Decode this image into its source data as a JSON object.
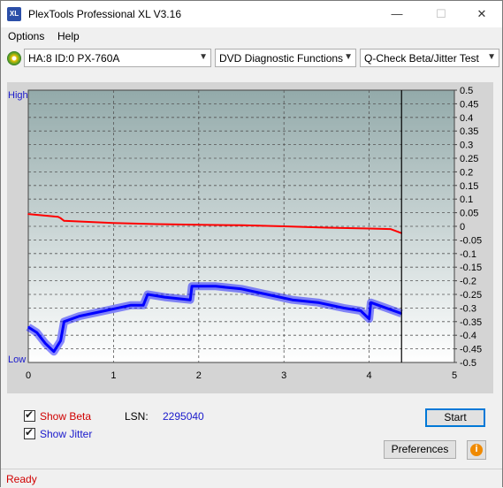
{
  "window": {
    "title": "PlexTools Professional XL V3.16",
    "icon_label": "XL",
    "controls": {
      "minimize": "—",
      "maximize": "☐",
      "close": "✕"
    }
  },
  "menu": {
    "options": "Options",
    "help": "Help"
  },
  "toolbar": {
    "drive": "HA:8 ID:0  PX-760A",
    "function": "DVD Diagnostic Functions",
    "test": "Q-Check Beta/Jitter Test"
  },
  "chart_data": {
    "type": "line",
    "y_labels_left": {
      "top": "High",
      "bottom": "Low"
    },
    "xlim": [
      0,
      5
    ],
    "x_ticks": [
      "0",
      "1",
      "2",
      "3",
      "4",
      "5"
    ],
    "ylim": [
      -0.5,
      0.5
    ],
    "y_ticks": [
      "0.5",
      "0.45",
      "0.4",
      "0.35",
      "0.3",
      "0.25",
      "0.2",
      "0.15",
      "0.1",
      "0.05",
      "0",
      "-0.05",
      "-0.1",
      "-0.15",
      "-0.2",
      "-0.25",
      "-0.3",
      "-0.35",
      "-0.4",
      "-0.45",
      "-0.5"
    ],
    "end_marker_x": 4.38,
    "grid": true,
    "series": [
      {
        "color": "#ff0000",
        "points": [
          [
            0,
            0.045
          ],
          [
            0.35,
            0.035
          ],
          [
            0.38,
            0.03
          ],
          [
            0.42,
            0.02
          ],
          [
            1,
            0.012
          ],
          [
            1.5,
            0.008
          ],
          [
            2,
            0.006
          ],
          [
            2.5,
            0.004
          ],
          [
            3,
            0.0
          ],
          [
            3.5,
            -0.005
          ],
          [
            4,
            -0.008
          ],
          [
            4.25,
            -0.01
          ],
          [
            4.38,
            -0.025
          ]
        ]
      },
      {
        "color": "#0000ff",
        "points": [
          [
            0,
            -0.37
          ],
          [
            0.1,
            -0.39
          ],
          [
            0.2,
            -0.43
          ],
          [
            0.3,
            -0.46
          ],
          [
            0.38,
            -0.42
          ],
          [
            0.42,
            -0.35
          ],
          [
            0.6,
            -0.33
          ],
          [
            0.9,
            -0.31
          ],
          [
            1.2,
            -0.29
          ],
          [
            1.35,
            -0.29
          ],
          [
            1.4,
            -0.25
          ],
          [
            1.6,
            -0.26
          ],
          [
            1.9,
            -0.27
          ],
          [
            1.92,
            -0.22
          ],
          [
            2.2,
            -0.22
          ],
          [
            2.5,
            -0.23
          ],
          [
            2.8,
            -0.25
          ],
          [
            3.1,
            -0.27
          ],
          [
            3.4,
            -0.28
          ],
          [
            3.7,
            -0.3
          ],
          [
            3.9,
            -0.31
          ],
          [
            4.0,
            -0.34
          ],
          [
            4.02,
            -0.28
          ],
          [
            4.2,
            -0.3
          ],
          [
            4.38,
            -0.32
          ]
        ]
      }
    ]
  },
  "options_panel": {
    "show_beta": "Show Beta",
    "show_jitter": "Show Jitter",
    "lsn_label": "LSN:",
    "lsn_value": "2295040",
    "start_button": "Start",
    "preferences_button": "Preferences",
    "info_icon": "i"
  },
  "status": {
    "text": "Ready"
  },
  "colors": {
    "beta": "#ff0000",
    "jitter": "#0000ff",
    "lsn_value": "#1a1acc",
    "status": "#d00000"
  }
}
